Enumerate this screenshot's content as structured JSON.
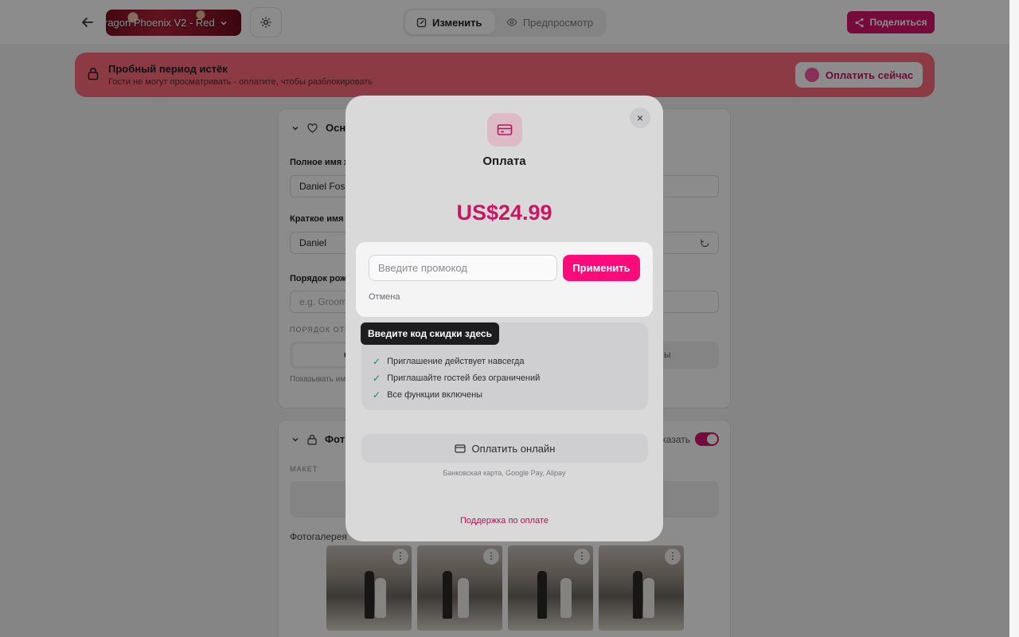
{
  "topbar": {
    "theme_name": "ragon Phoenix V2 - Red",
    "edit_label": "Изменить",
    "preview_label": "Предпросмотр",
    "share_label": "Поделиться"
  },
  "banner": {
    "title": "Пробный период истёк",
    "subtitle": "Гости не могут просматривать - оплатите, чтобы разблокировать",
    "pay_now_label": "Оплатить сейчас"
  },
  "form": {
    "section1_title": "Осн",
    "full_name_label": "Полное имя ж",
    "full_name_value": "Daniel Fos",
    "short_name_label": "Краткое имя",
    "short_name_value": "Daniel",
    "birth_order_label": "Порядок рож",
    "birth_order_placeholder": "e.g. Groom",
    "parents_caps": "ПОРЯДОК ОТЕ",
    "segment_left": "С",
    "segment_right": "ы",
    "hint": "Показывать им",
    "section2_title": "Фот",
    "show_label": "казать",
    "layout_caps": "МАКЕТ",
    "gallery_label": "Фотогалерея"
  },
  "modal": {
    "title": "Оплата",
    "price": "US$24.99",
    "promo_placeholder": "Введите промокод",
    "apply_label": "Применить",
    "cancel_label": "Отмена",
    "tooltip": "Введите код скидки здесь",
    "features": [
      "Приглашение действует навсегда",
      "Приглашайте гостей без ограничений",
      "Все функции включены"
    ],
    "pay_online_label": "Оплатить онлайн",
    "pay_methods": "Банковская карта, Google Pay, Alipay",
    "support_label": "Поддержка по оплате",
    "close_icon": "×"
  },
  "colors": {
    "accent": "#ff0a7a",
    "brand": "#d6156a",
    "banner": "#ff6b7c",
    "price": "#e41b74"
  },
  "icons": [
    "arrow-left-icon",
    "chevron-down-icon",
    "gear-icon",
    "pencil-icon",
    "eye-icon",
    "share-icon",
    "lock-icon",
    "heart-icon",
    "refresh-icon",
    "credit-card-icon",
    "check-icon",
    "close-icon",
    "more-vertical-icon"
  ]
}
